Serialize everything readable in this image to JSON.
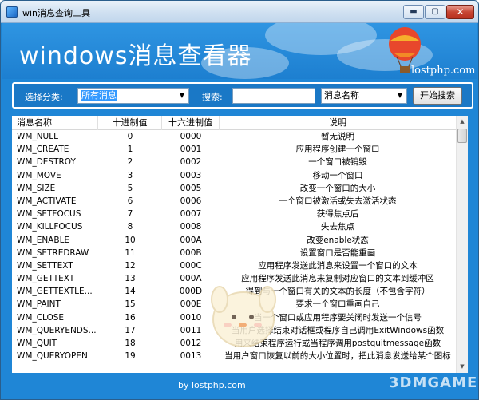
{
  "window": {
    "title": "win消息查询工具",
    "buttons": {
      "minimize": "▬",
      "maximize": "▢",
      "close": "✕"
    }
  },
  "banner": {
    "title": "windows消息查看器",
    "site": "lostphp.com"
  },
  "toolbar": {
    "category_label": "选择分类:",
    "category_value": "所有消息",
    "search_label": "搜索:",
    "search_value": "",
    "field_value": "消息名称",
    "search_button": "开始搜索"
  },
  "table": {
    "columns": [
      "消息名称",
      "十进制值",
      "十六进制值",
      "说明"
    ],
    "rows": [
      [
        "WM_NULL",
        "0",
        "0000",
        "暂无说明"
      ],
      [
        "WM_CREATE",
        "1",
        "0001",
        "应用程序创建一个窗口"
      ],
      [
        "WM_DESTROY",
        "2",
        "0002",
        "一个窗口被销毁"
      ],
      [
        "WM_MOVE",
        "3",
        "0003",
        "移动一个窗口"
      ],
      [
        "WM_SIZE",
        "5",
        "0005",
        "改变一个窗口的大小"
      ],
      [
        "WM_ACTIVATE",
        "6",
        "0006",
        "一个窗口被激活或失去激活状态"
      ],
      [
        "WM_SETFOCUS",
        "7",
        "0007",
        "获得焦点后"
      ],
      [
        "WM_KILLFOCUS",
        "8",
        "0008",
        "失去焦点"
      ],
      [
        "WM_ENABLE",
        "10",
        "000A",
        "改变enable状态"
      ],
      [
        "WM_SETREDRAW",
        "11",
        "000B",
        "设置窗口是否能重画"
      ],
      [
        "WM_SETTEXT",
        "12",
        "000C",
        "应用程序发送此消息来设置一个窗口的文本"
      ],
      [
        "WM_GETTEXT",
        "13",
        "000A",
        "应用程序发送此消息来复制对应窗口的文本到缓冲区"
      ],
      [
        "WM_GETTEXTLE...",
        "14",
        "000D",
        "得到与一个窗口有关的文本的长度（不包含字符）"
      ],
      [
        "WM_PAINT",
        "15",
        "000E",
        "要求一个窗口重画自己"
      ],
      [
        "WM_CLOSE",
        "16",
        "0010",
        "当一个窗口或应用程序要关闭时发送一个信号"
      ],
      [
        "WM_QUERYENDS...",
        "17",
        "0011",
        "当用户选择结束对话框或程序自己调用ExitWindows函数"
      ],
      [
        "WM_QUIT",
        "18",
        "0012",
        "用来结束程序运行或当程序调用postquitmessage函数"
      ],
      [
        "WM_QUERYOPEN",
        "19",
        "0013",
        "当用户窗口恢复以前的大小位置时，把此消息发送给某个图标"
      ]
    ]
  },
  "footer": {
    "text": "by lostphp.com",
    "watermark": "3DMGAME"
  },
  "scrollbar": {
    "up": "▲",
    "down": "▼"
  },
  "icons": {
    "app": "app-icon",
    "balloon": "hot-air-balloon-icon",
    "mascot": "mascot-decoration",
    "dropdown": "chevron-down-icon"
  },
  "colors": {
    "accent": "#1f86d6",
    "selection": "#3399ff",
    "close": "#c84634"
  }
}
